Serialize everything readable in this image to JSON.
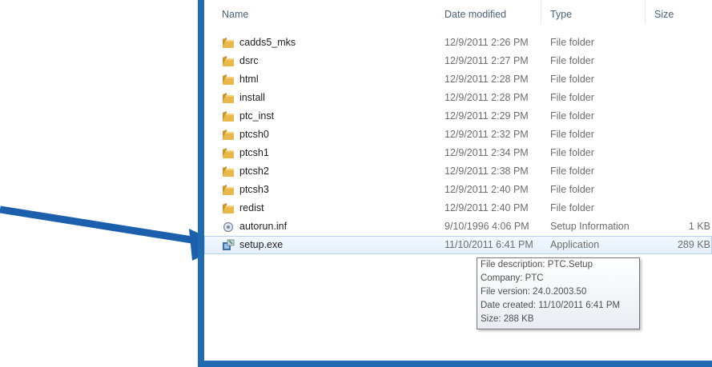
{
  "columns": {
    "name": "Name",
    "date_modified": "Date modified",
    "type": "Type",
    "size": "Size"
  },
  "files": [
    {
      "name": "cadds5_mks",
      "date": "12/9/2011 2:26 PM",
      "type": "File folder",
      "size": "",
      "icon": "folder-icon"
    },
    {
      "name": "dsrc",
      "date": "12/9/2011 2:27 PM",
      "type": "File folder",
      "size": "",
      "icon": "folder-icon"
    },
    {
      "name": "html",
      "date": "12/9/2011 2:28 PM",
      "type": "File folder",
      "size": "",
      "icon": "folder-icon"
    },
    {
      "name": "install",
      "date": "12/9/2011 2:28 PM",
      "type": "File folder",
      "size": "",
      "icon": "folder-icon"
    },
    {
      "name": "ptc_inst",
      "date": "12/9/2011 2:29 PM",
      "type": "File folder",
      "size": "",
      "icon": "folder-icon"
    },
    {
      "name": "ptcsh0",
      "date": "12/9/2011 2:32 PM",
      "type": "File folder",
      "size": "",
      "icon": "folder-icon"
    },
    {
      "name": "ptcsh1",
      "date": "12/9/2011 2:34 PM",
      "type": "File folder",
      "size": "",
      "icon": "folder-icon"
    },
    {
      "name": "ptcsh2",
      "date": "12/9/2011 2:38 PM",
      "type": "File folder",
      "size": "",
      "icon": "folder-icon"
    },
    {
      "name": "ptcsh3",
      "date": "12/9/2011 2:40 PM",
      "type": "File folder",
      "size": "",
      "icon": "folder-icon"
    },
    {
      "name": "redist",
      "date": "12/9/2011 2:40 PM",
      "type": "File folder",
      "size": "",
      "icon": "folder-icon"
    },
    {
      "name": "autorun.inf",
      "date": "9/10/1996 4:06 PM",
      "type": "Setup Information",
      "size": "1 KB",
      "icon": "setup-info-icon"
    },
    {
      "name": "setup.exe",
      "date": "11/10/2011 6:41 PM",
      "type": "Application",
      "size": "289 KB",
      "icon": "setup-exe-icon",
      "selected": true
    }
  ],
  "tooltip": {
    "description": "File description: PTC.Setup",
    "company": "Company: PTC",
    "version": "File version: 24.0.2003.50",
    "created": "Date created: 11/10/2011 6:41 PM",
    "size": "Size: 288 KB"
  },
  "colors": {
    "frame": "#1f6ab1",
    "arrow": "#1b5fad",
    "folder": "#e8b84a",
    "selection": "#e3effc"
  }
}
